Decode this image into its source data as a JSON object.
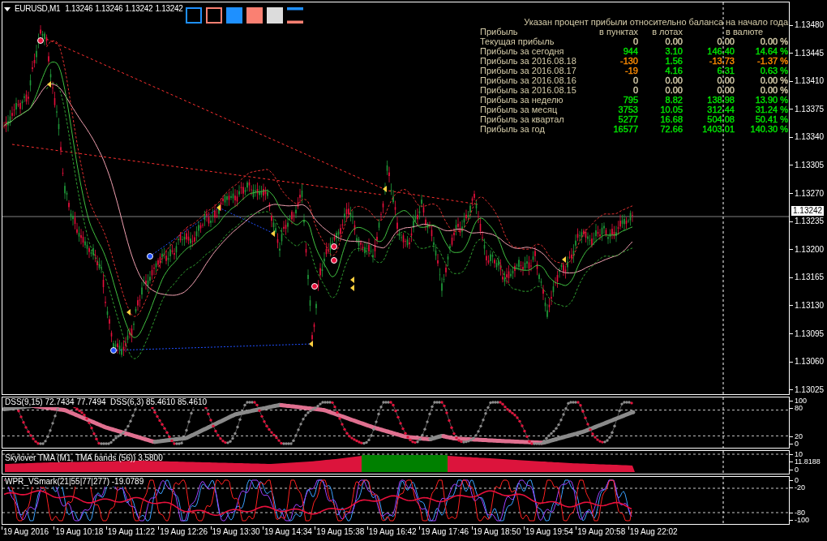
{
  "chart": {
    "symbol": "EURUSD,M1",
    "quotes": [
      "1.13246",
      "1.13246",
      "1.13242",
      "1.13242"
    ]
  },
  "toolbar": [
    {
      "kind": "outline",
      "color": "#1e90ff"
    },
    {
      "kind": "outline",
      "color": "#fa8072"
    },
    {
      "kind": "filled",
      "color": "#1e90ff"
    },
    {
      "kind": "filled",
      "color": "#fa8072"
    },
    {
      "kind": "filled",
      "color": "#dcdcdc"
    },
    {
      "kind": "lines"
    }
  ],
  "profit_table": {
    "title": "Указан процент прибыли относительно баланса на начало года",
    "columns": [
      "Прибыль",
      "в пунктах",
      "в лотах",
      "в валюте"
    ],
    "rows": [
      {
        "cells": [
          {
            "text": "Текущая прибыль"
          },
          {
            "text": "0",
            "color": "#d6cdaa"
          },
          {
            "text": "0.00",
            "color": "#d6cdaa"
          },
          {
            "text": "0.00",
            "color": "#d6cdaa"
          },
          {
            "text": "0.00 %",
            "color": "#d6cdaa"
          }
        ]
      },
      {
        "cells": [
          {
            "text": "Прибыль за сегодня"
          },
          {
            "text": "944",
            "color": "#00e600"
          },
          {
            "text": "3.10",
            "color": "#00e600"
          },
          {
            "text": "146.40",
            "color": "#00e600"
          },
          {
            "text": "14.64 %",
            "color": "#00e600"
          }
        ]
      },
      {
        "cells": [
          {
            "text": "Прибыль за 2016.08.18"
          },
          {
            "text": "-130",
            "color": "#ff8c00"
          },
          {
            "text": "1.56",
            "color": "#00e600"
          },
          {
            "text": "-13.73",
            "color": "#ff8c00"
          },
          {
            "text": "-1.37 %",
            "color": "#ff8c00"
          }
        ]
      },
      {
        "cells": [
          {
            "text": "Прибыль за 2016.08.17"
          },
          {
            "text": "-19",
            "color": "#ff8c00"
          },
          {
            "text": "4.16",
            "color": "#00e600"
          },
          {
            "text": "6.31",
            "color": "#00e600"
          },
          {
            "text": "0.63 %",
            "color": "#00e600"
          }
        ]
      },
      {
        "cells": [
          {
            "text": "Прибыль за 2016.08.16"
          },
          {
            "text": "0",
            "color": "#d6cdaa"
          },
          {
            "text": "0.00",
            "color": "#d6cdaa"
          },
          {
            "text": "0.00",
            "color": "#d6cdaa"
          },
          {
            "text": "0.00 %",
            "color": "#d6cdaa"
          }
        ]
      },
      {
        "cells": [
          {
            "text": "Прибыль за 2016.08.15"
          },
          {
            "text": "0",
            "color": "#d6cdaa"
          },
          {
            "text": "0.00",
            "color": "#d6cdaa"
          },
          {
            "text": "0.00",
            "color": "#d6cdaa"
          },
          {
            "text": "0.00 %",
            "color": "#d6cdaa"
          }
        ]
      },
      {
        "cells": [
          {
            "text": "Прибыль за неделю"
          },
          {
            "text": "795",
            "color": "#00e600"
          },
          {
            "text": "8.82",
            "color": "#00e600"
          },
          {
            "text": "138.98",
            "color": "#00e600"
          },
          {
            "text": "13.90 %",
            "color": "#00e600"
          }
        ]
      },
      {
        "cells": [
          {
            "text": "Прибыль за месяц"
          },
          {
            "text": "3753",
            "color": "#00e600"
          },
          {
            "text": "10.05",
            "color": "#00e600"
          },
          {
            "text": "312.44",
            "color": "#00e600"
          },
          {
            "text": "31.24 %",
            "color": "#00e600"
          }
        ]
      },
      {
        "cells": [
          {
            "text": "Прибыль за квартал"
          },
          {
            "text": "5277",
            "color": "#00e600"
          },
          {
            "text": "16.68",
            "color": "#00e600"
          },
          {
            "text": "504.08",
            "color": "#00e600"
          },
          {
            "text": "50.41 %",
            "color": "#00e600"
          }
        ]
      },
      {
        "cells": [
          {
            "text": "Прибыль за год"
          },
          {
            "text": "16577",
            "color": "#00e600"
          },
          {
            "text": "72.66",
            "color": "#00e600"
          },
          {
            "text": "1403.01",
            "color": "#00e600"
          },
          {
            "text": "140.30 %",
            "color": "#00e600"
          }
        ]
      }
    ]
  },
  "price_axis": {
    "labels": [
      "1.13480",
      "1.13445",
      "1.13410",
      "1.13375",
      "1.13340",
      "1.13305",
      "1.13270",
      "1.13235",
      "1.13200",
      "1.13165",
      "1.13130",
      "1.13095",
      "1.13060",
      "1.13025"
    ],
    "current_price": "1.13242"
  },
  "indicators": [
    {
      "kind": "dss",
      "label": "DSS(9,15) 72.7434 77.7494  DSS(6,3) 85.4610 85.4610",
      "scale": [
        "100",
        "80",
        "20",
        "0"
      ]
    },
    {
      "kind": "tma",
      "label": "Skylover TMA (M1, TMA bands (56)) 3.5800",
      "scale": [
        "10",
        "11.8188",
        "0"
      ]
    },
    {
      "kind": "wpr",
      "label": "WPR_VSmark(21|55|77|277) -19.0789",
      "scale": [
        "0",
        "-20",
        "-80",
        "-100"
      ]
    }
  ],
  "time_axis": {
    "labels": [
      "19 Aug 2016",
      "19 Aug 10:18",
      "19 Aug 11:22",
      "19 Aug 12:26",
      "19 Aug 13:30",
      "19 Aug 14:34",
      "19 Aug 15:38",
      "19 Aug 16:42",
      "19 Aug 17:46",
      "19 Aug 18:50",
      "19 Aug 19:54",
      "19 Aug 20:58",
      "19 Aug 22:02"
    ]
  }
}
